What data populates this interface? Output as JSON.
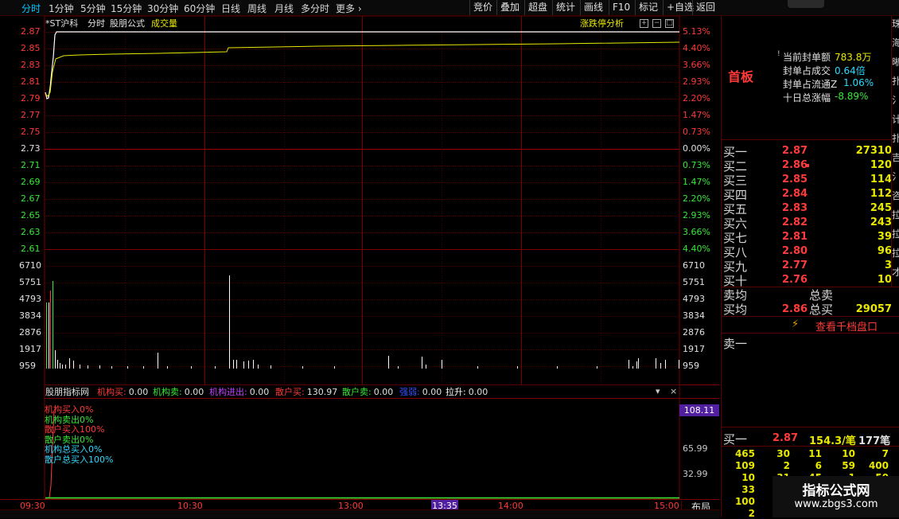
{
  "toolbar": {
    "periods": [
      "分时",
      "1分钟",
      "5分钟",
      "15分钟",
      "30分钟",
      "60分钟",
      "日线",
      "周线",
      "月线",
      "多分时",
      "更多"
    ],
    "right_buttons": [
      "竞价",
      "叠加",
      "超盘",
      "统计",
      "画线",
      "F10",
      "标记",
      "+自选",
      "返回"
    ]
  },
  "chart_header": {
    "stock": "*ST沪科",
    "mode": "分时",
    "formula": "股朋公式",
    "indicator": "成交量",
    "analysis": "涨跌停分析"
  },
  "price_axis": {
    "left": [
      "2.87",
      "2.85",
      "2.83",
      "2.81",
      "2.79",
      "2.77",
      "2.75",
      "2.73",
      "2.71",
      "2.69",
      "2.67",
      "2.65",
      "2.63",
      "2.61"
    ],
    "right": [
      "5.13%",
      "4.40%",
      "3.66%",
      "2.93%",
      "2.20%",
      "1.47%",
      "0.73%",
      "0.00%",
      "0.73%",
      "1.47%",
      "2.20%",
      "2.93%",
      "3.66%",
      "4.40%"
    ]
  },
  "volume_axis": [
    "6710",
    "5751",
    "4793",
    "3834",
    "2876",
    "1917",
    "959"
  ],
  "indicator_bar": {
    "name": "股朋指标网",
    "items": [
      {
        "label": "机构买:",
        "value": "0.00",
        "color": "#ff3a3a"
      },
      {
        "label": "机构卖:",
        "value": "0.00",
        "color": "#38e838"
      },
      {
        "label": "机构进出:",
        "value": "0.00",
        "color": "#c040ff"
      },
      {
        "label": "散户买:",
        "value": "130.97",
        "color": "#ff3a3a"
      },
      {
        "label": "散户卖:",
        "value": "0.00",
        "color": "#38e838"
      },
      {
        "label": "强弱:",
        "value": "0.00",
        "color": "#3050ff"
      },
      {
        "label": "拉升:",
        "value": "0.00",
        "color": "#ffffff"
      }
    ]
  },
  "indicator_legend": [
    {
      "text": "机构买入0%",
      "color": "#ff3a3a"
    },
    {
      "text": "机构卖出0%",
      "color": "#38e838"
    },
    {
      "text": "散户买入100%",
      "color": "#ff3a3a"
    },
    {
      "text": "散户卖出0%",
      "color": "#38e838"
    },
    {
      "text": "机构总买入0%",
      "color": "#30d8ff"
    },
    {
      "text": "散户总买入100%",
      "color": "#30d8ff"
    }
  ],
  "indicator_axis": {
    "current": "108.11",
    "mid": "65.99",
    "low": "32.99"
  },
  "time_axis": {
    "labels": [
      "09:30",
      "10:30",
      "13:00",
      "14:00",
      "15:00"
    ],
    "cursor": "13:35",
    "layout_btn": "布局"
  },
  "seal": {
    "board": "首板",
    "rows": [
      {
        "label": "当前封单额",
        "value": "783.8万",
        "color": "#e8e800"
      },
      {
        "label": "封单占成交",
        "value": "0.64倍",
        "color": "#30d8ff"
      },
      {
        "label": "封单占流通Z",
        "value": "1.06%",
        "color": "#30d8ff"
      },
      {
        "label": "十日总涨幅",
        "value": "-8.89%",
        "color": "#38e838"
      }
    ]
  },
  "order_book": {
    "buy": [
      {
        "label": "买一",
        "price": "2.87",
        "volume": "27310"
      },
      {
        "label": "买二",
        "price": "2.86",
        "volume": "120"
      },
      {
        "label": "买三",
        "price": "2.85",
        "volume": "114"
      },
      {
        "label": "买四",
        "price": "2.84",
        "volume": "112"
      },
      {
        "label": "买五",
        "price": "2.83",
        "volume": "245"
      },
      {
        "label": "买六",
        "price": "2.82",
        "volume": "243"
      },
      {
        "label": "买七",
        "price": "2.81",
        "volume": "39"
      },
      {
        "label": "买八",
        "price": "2.80",
        "volume": "96"
      },
      {
        "label": "买九",
        "price": "2.77",
        "volume": "3"
      },
      {
        "label": "买十",
        "price": "2.76",
        "volume": "10"
      }
    ],
    "sell_avg_label": "卖均",
    "total_sell_label": "总卖",
    "buy_avg_label": "买均",
    "buy_avg": "2.86",
    "total_buy_label": "总买",
    "total_buy": "29057",
    "thousand_btn": "查看千档盘口",
    "sell_one": "卖一"
  },
  "trade_summary": {
    "label": "买一",
    "price": "2.87",
    "amount": "154.3/笔",
    "count": "177笔"
  },
  "trade_grid": [
    [
      "465",
      "30",
      "11",
      "10",
      "7"
    ],
    [
      "109",
      "2",
      "6",
      "59",
      "400"
    ],
    [
      "10",
      "31",
      "45",
      "1",
      "50"
    ],
    [
      "33",
      "",
      "",
      "",
      ""
    ],
    [
      "100",
      "",
      "",
      "",
      ""
    ],
    [
      "2",
      "",
      "",
      "",
      ""
    ]
  ],
  "watermark": {
    "title": "指标公式网",
    "url": "www.zbgs3.com"
  },
  "side_strip": [
    "珠",
    "海",
    "晰",
    "扑",
    "氵",
    "计",
    "扑",
    "吉",
    "氵",
    "咨",
    "拉",
    "拉",
    "拉",
    "才"
  ]
}
